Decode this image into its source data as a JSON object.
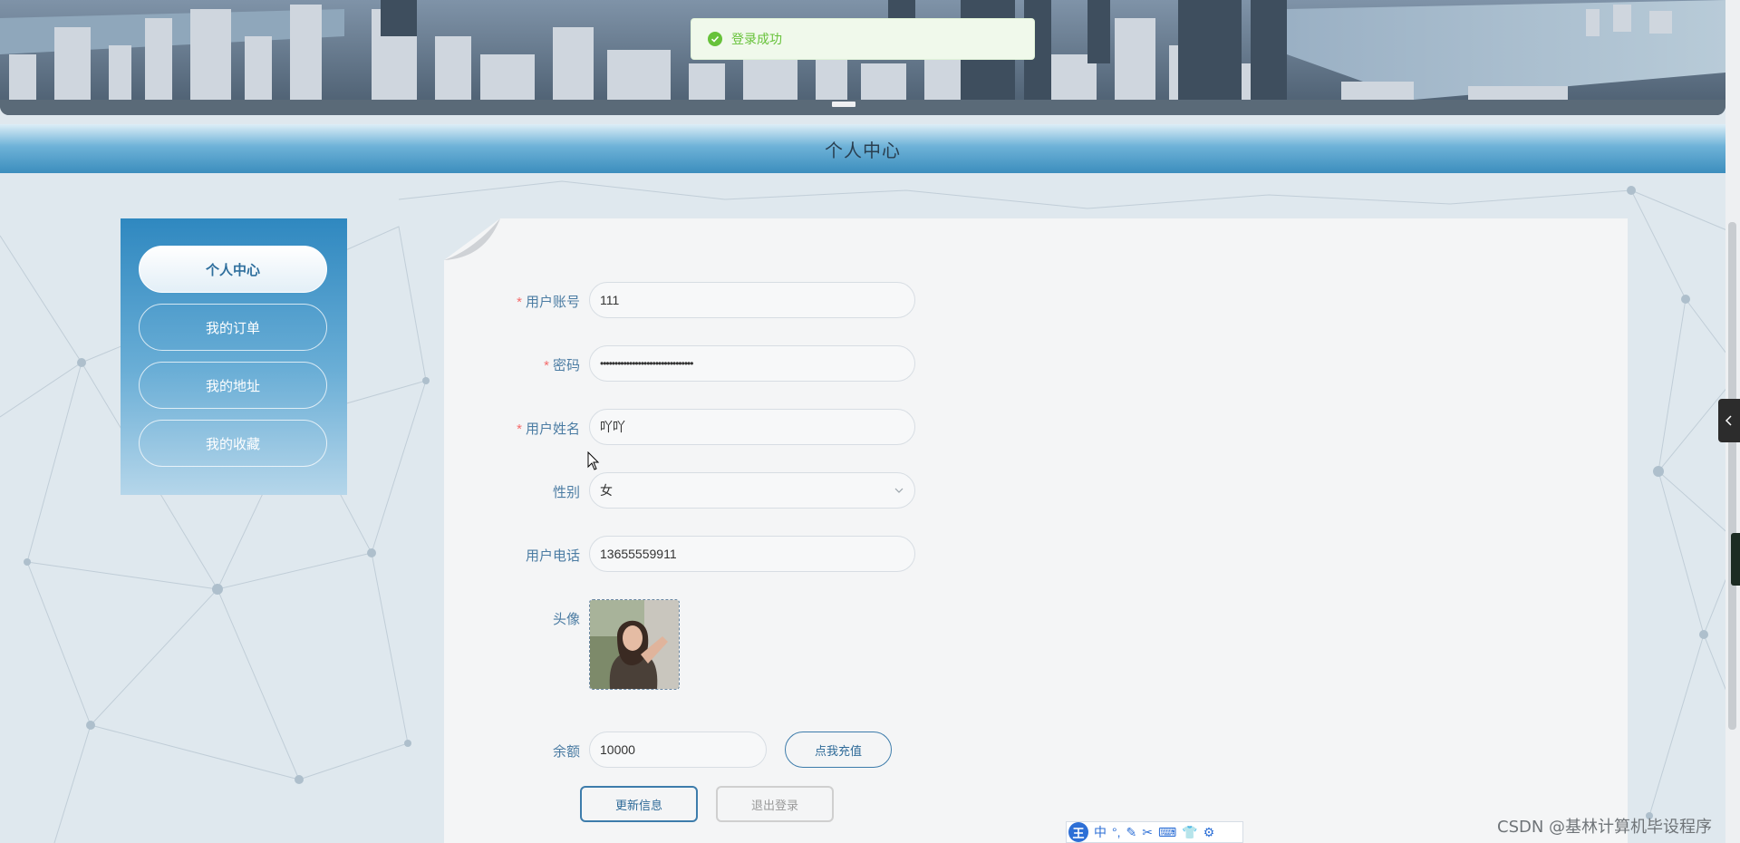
{
  "toast": {
    "message": "登录成功",
    "icon": "check-circle-icon",
    "color": "#67c23a"
  },
  "page": {
    "title": "个人中心"
  },
  "sidebar": {
    "items": [
      {
        "label": "个人中心",
        "active": true
      },
      {
        "label": "我的订单",
        "active": false
      },
      {
        "label": "我的地址",
        "active": false
      },
      {
        "label": "我的收藏",
        "active": false
      }
    ]
  },
  "form": {
    "username": {
      "label": "用户账号",
      "value": "111",
      "required": true
    },
    "password": {
      "label": "密码",
      "value": "••••••••••••••••••••••••••••••••",
      "required": true
    },
    "name": {
      "label": "用户姓名",
      "value": "吖吖",
      "required": true
    },
    "gender": {
      "label": "性别",
      "value": "女"
    },
    "phone": {
      "label": "用户电话",
      "value": "13655559911"
    },
    "avatar": {
      "label": "头像"
    },
    "balance": {
      "label": "余额",
      "value": "10000"
    },
    "recharge_label": "点我充值",
    "update_label": "更新信息",
    "logout_label": "退出登录",
    "required_mark": "*"
  },
  "ime": {
    "logo": "王",
    "mode": "中",
    "icons": [
      "punctuation-icon",
      "pen-icon",
      "scissors-icon",
      "keyboard-icon",
      "shirt-icon",
      "gear-icon"
    ]
  },
  "watermark": "CSDN @基林计算机毕设程序",
  "colors": {
    "accent": "#3d7cab",
    "title_bar": "#3c8ebd",
    "required": "#f56c6c"
  }
}
